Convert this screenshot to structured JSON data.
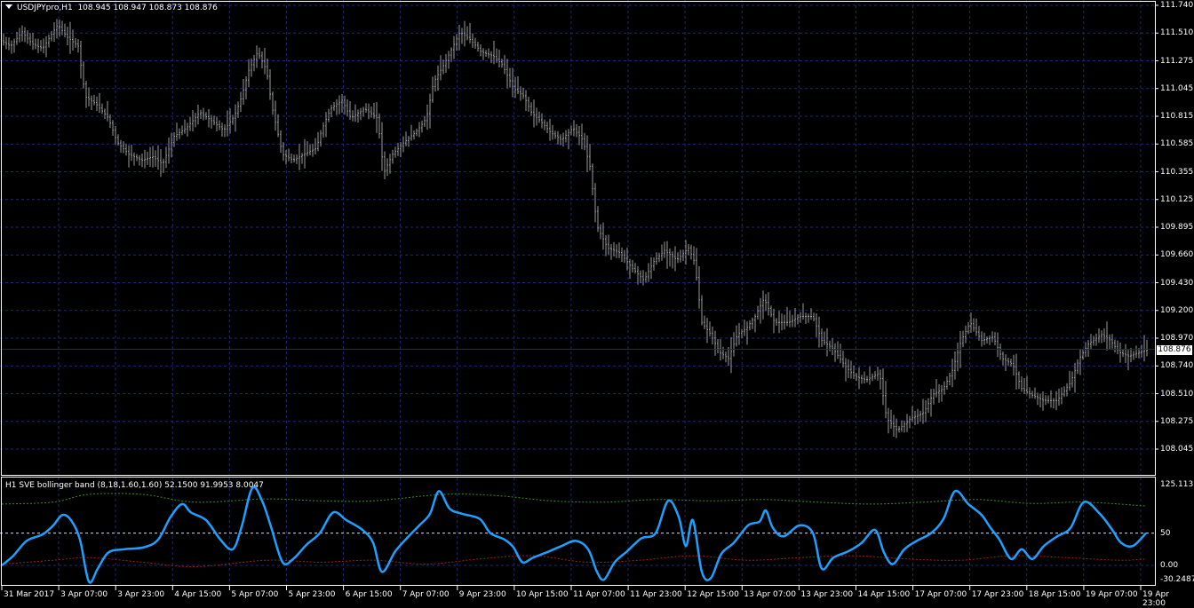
{
  "main_chart": {
    "symbol": "USDJPYpro,H1",
    "ohlc": "108.945 108.947 108.873 108.876",
    "y_ticks": [
      "111.740",
      "111.510",
      "111.275",
      "111.045",
      "110.815",
      "110.585",
      "110.355",
      "110.125",
      "109.895",
      "109.660",
      "109.430",
      "109.200",
      "108.970",
      "108.740",
      "108.510",
      "108.275",
      "108.045"
    ],
    "current_price": "108.876",
    "y_range": [
      108.045,
      111.74
    ],
    "bid_line_color": "#1e1e8c",
    "bar_color": "#9a9a9a",
    "grid_color": "#1f2a6b"
  },
  "indicator": {
    "title": "H1 SVE bollinger band (8,18,1.60,1.60) 52.1500 91.9953 8.0047",
    "y_ticks": [
      "125.1137",
      "50",
      "0.00",
      "-30.2487"
    ],
    "y_range": [
      -30.2487,
      125.1137
    ],
    "level_50_color": "#d9d9d9",
    "main_line_color": "#1ea0ff",
    "upper_band_color": "#3a8c2a",
    "lower_band_color": "#a01e1e"
  },
  "x_ticks": [
    "31 Mar 2017",
    "3 Apr 07:00",
    "3 Apr 23:00",
    "4 Apr 15:00",
    "5 Apr 07:00",
    "5 Apr 23:00",
    "6 Apr 15:00",
    "7 Apr 07:00",
    "9 Apr 23:00",
    "10 Apr 15:00",
    "11 Apr 07:00",
    "11 Apr 23:00",
    "12 Apr 15:00",
    "13 Apr 07:00",
    "13 Apr 23:00",
    "14 Apr 15:00",
    "17 Apr 07:00",
    "17 Apr 23:00",
    "18 Apr 15:00",
    "19 Apr 07:00",
    "19 Apr 23:00"
  ],
  "chart_data": {
    "type": "line",
    "price_path_nodes": [
      [
        0,
        111.45
      ],
      [
        12,
        111.4
      ],
      [
        25,
        111.52
      ],
      [
        36,
        111.42
      ],
      [
        48,
        111.38
      ],
      [
        58,
        111.5
      ],
      [
        65,
        111.58
      ],
      [
        75,
        111.48
      ],
      [
        88,
        111.4
      ],
      [
        96,
        110.98
      ],
      [
        108,
        110.92
      ],
      [
        122,
        110.8
      ],
      [
        132,
        110.6
      ],
      [
        145,
        110.5
      ],
      [
        160,
        110.45
      ],
      [
        172,
        110.48
      ],
      [
        183,
        110.42
      ],
      [
        196,
        110.65
      ],
      [
        210,
        110.72
      ],
      [
        225,
        110.85
      ],
      [
        238,
        110.78
      ],
      [
        252,
        110.7
      ],
      [
        264,
        110.82
      ],
      [
        272,
        110.98
      ],
      [
        280,
        111.2
      ],
      [
        290,
        111.35
      ],
      [
        300,
        111.2
      ],
      [
        306,
        110.9
      ],
      [
        318,
        110.5
      ],
      [
        330,
        110.45
      ],
      [
        342,
        110.5
      ],
      [
        356,
        110.55
      ],
      [
        362,
        110.7
      ],
      [
        372,
        110.88
      ],
      [
        385,
        110.95
      ],
      [
        395,
        110.8
      ],
      [
        410,
        110.88
      ],
      [
        425,
        110.8
      ],
      [
        432,
        110.35
      ],
      [
        442,
        110.5
      ],
      [
        455,
        110.6
      ],
      [
        470,
        110.7
      ],
      [
        480,
        110.8
      ],
      [
        488,
        111.1
      ],
      [
        500,
        111.25
      ],
      [
        510,
        111.4
      ],
      [
        518,
        111.52
      ],
      [
        530,
        111.45
      ],
      [
        542,
        111.35
      ],
      [
        555,
        111.32
      ],
      [
        565,
        111.25
      ],
      [
        578,
        111.05
      ],
      [
        590,
        110.98
      ],
      [
        598,
        110.85
      ],
      [
        608,
        110.78
      ],
      [
        620,
        110.68
      ],
      [
        632,
        110.62
      ],
      [
        645,
        110.72
      ],
      [
        656,
        110.62
      ],
      [
        664,
        110.4
      ],
      [
        672,
        109.9
      ],
      [
        684,
        109.72
      ],
      [
        698,
        109.68
      ],
      [
        712,
        109.55
      ],
      [
        725,
        109.45
      ],
      [
        735,
        109.6
      ],
      [
        748,
        109.7
      ],
      [
        762,
        109.62
      ],
      [
        775,
        109.72
      ],
      [
        782,
        109.6
      ],
      [
        790,
        109.1
      ],
      [
        800,
        109.0
      ],
      [
        810,
        108.85
      ],
      [
        820,
        108.8
      ],
      [
        830,
        109.0
      ],
      [
        840,
        109.05
      ],
      [
        850,
        109.15
      ],
      [
        860,
        109.3
      ],
      [
        872,
        109.1
      ],
      [
        888,
        109.1
      ],
      [
        900,
        109.15
      ],
      [
        915,
        109.15
      ],
      [
        925,
        108.95
      ],
      [
        938,
        108.88
      ],
      [
        950,
        108.75
      ],
      [
        962,
        108.65
      ],
      [
        975,
        108.62
      ],
      [
        990,
        108.68
      ],
      [
        998,
        108.3
      ],
      [
        1010,
        108.2
      ],
      [
        1025,
        108.3
      ],
      [
        1040,
        108.35
      ],
      [
        1050,
        108.5
      ],
      [
        1062,
        108.55
      ],
      [
        1072,
        108.7
      ],
      [
        1082,
        108.95
      ],
      [
        1092,
        109.1
      ],
      [
        1105,
        108.95
      ],
      [
        1118,
        108.98
      ],
      [
        1128,
        108.8
      ],
      [
        1140,
        108.75
      ],
      [
        1150,
        108.55
      ],
      [
        1160,
        108.5
      ],
      [
        1175,
        108.45
      ],
      [
        1190,
        108.45
      ],
      [
        1205,
        108.6
      ],
      [
        1215,
        108.8
      ],
      [
        1225,
        108.92
      ],
      [
        1240,
        109.0
      ],
      [
        1250,
        108.95
      ],
      [
        1260,
        108.85
      ],
      [
        1270,
        108.82
      ],
      [
        1282,
        108.85
      ],
      [
        1293,
        108.876
      ]
    ],
    "indicator_main": [
      [
        2,
        0
      ],
      [
        15,
        15
      ],
      [
        30,
        38
      ],
      [
        48,
        48
      ],
      [
        60,
        62
      ],
      [
        70,
        78
      ],
      [
        80,
        70
      ],
      [
        90,
        40
      ],
      [
        100,
        -25
      ],
      [
        110,
        -5
      ],
      [
        122,
        20
      ],
      [
        140,
        25
      ],
      [
        162,
        28
      ],
      [
        178,
        40
      ],
      [
        192,
        75
      ],
      [
        205,
        95
      ],
      [
        215,
        82
      ],
      [
        232,
        70
      ],
      [
        248,
        40
      ],
      [
        262,
        25
      ],
      [
        272,
        60
      ],
      [
        284,
        120
      ],
      [
        295,
        100
      ],
      [
        305,
        60
      ],
      [
        318,
        5
      ],
      [
        330,
        10
      ],
      [
        345,
        32
      ],
      [
        360,
        50
      ],
      [
        375,
        82
      ],
      [
        390,
        70
      ],
      [
        408,
        55
      ],
      [
        420,
        35
      ],
      [
        430,
        -10
      ],
      [
        445,
        22
      ],
      [
        460,
        45
      ],
      [
        472,
        62
      ],
      [
        484,
        80
      ],
      [
        494,
        115
      ],
      [
        506,
        88
      ],
      [
        520,
        80
      ],
      [
        540,
        72
      ],
      [
        552,
        50
      ],
      [
        568,
        40
      ],
      [
        578,
        28
      ],
      [
        588,
        5
      ],
      [
        600,
        12
      ],
      [
        615,
        20
      ],
      [
        632,
        30
      ],
      [
        648,
        38
      ],
      [
        662,
        25
      ],
      [
        672,
        -10
      ],
      [
        680,
        -22
      ],
      [
        692,
        5
      ],
      [
        706,
        22
      ],
      [
        722,
        42
      ],
      [
        738,
        50
      ],
      [
        752,
        100
      ],
      [
        764,
        75
      ],
      [
        772,
        30
      ],
      [
        780,
        70
      ],
      [
        790,
        -10
      ],
      [
        800,
        -20
      ],
      [
        812,
        18
      ],
      [
        826,
        35
      ],
      [
        842,
        62
      ],
      [
        855,
        68
      ],
      [
        862,
        85
      ],
      [
        870,
        58
      ],
      [
        882,
        45
      ],
      [
        900,
        62
      ],
      [
        915,
        50
      ],
      [
        925,
        -5
      ],
      [
        938,
        12
      ],
      [
        955,
        22
      ],
      [
        970,
        35
      ],
      [
        985,
        55
      ],
      [
        995,
        20
      ],
      [
        1005,
        2
      ],
      [
        1018,
        25
      ],
      [
        1032,
        38
      ],
      [
        1048,
        50
      ],
      [
        1062,
        72
      ],
      [
        1075,
        115
      ],
      [
        1090,
        95
      ],
      [
        1105,
        78
      ],
      [
        1115,
        58
      ],
      [
        1125,
        40
      ],
      [
        1138,
        10
      ],
      [
        1150,
        25
      ],
      [
        1162,
        10
      ],
      [
        1175,
        30
      ],
      [
        1190,
        45
      ],
      [
        1205,
        58
      ],
      [
        1220,
        98
      ],
      [
        1238,
        80
      ],
      [
        1252,
        55
      ],
      [
        1262,
        35
      ],
      [
        1275,
        30
      ],
      [
        1290,
        50
      ]
    ],
    "indicator_upper": [
      [
        2,
        95
      ],
      [
        60,
        98
      ],
      [
        100,
        110
      ],
      [
        160,
        110
      ],
      [
        220,
        98
      ],
      [
        300,
        103
      ],
      [
        360,
        100
      ],
      [
        420,
        100
      ],
      [
        500,
        110
      ],
      [
        560,
        108
      ],
      [
        620,
        100
      ],
      [
        680,
        98
      ],
      [
        740,
        102
      ],
      [
        800,
        100
      ],
      [
        860,
        102
      ],
      [
        920,
        98
      ],
      [
        980,
        95
      ],
      [
        1040,
        98
      ],
      [
        1100,
        102
      ],
      [
        1160,
        96
      ],
      [
        1220,
        98
      ],
      [
        1290,
        92
      ]
    ],
    "indicator_lower": [
      [
        2,
        2
      ],
      [
        60,
        8
      ],
      [
        100,
        12
      ],
      [
        160,
        5
      ],
      [
        220,
        -2
      ],
      [
        300,
        8
      ],
      [
        360,
        5
      ],
      [
        420,
        8
      ],
      [
        480,
        2
      ],
      [
        540,
        10
      ],
      [
        600,
        15
      ],
      [
        660,
        5
      ],
      [
        720,
        8
      ],
      [
        780,
        15
      ],
      [
        840,
        8
      ],
      [
        900,
        12
      ],
      [
        960,
        15
      ],
      [
        1020,
        10
      ],
      [
        1080,
        8
      ],
      [
        1140,
        15
      ],
      [
        1200,
        12
      ],
      [
        1260,
        8
      ],
      [
        1290,
        10
      ]
    ]
  }
}
